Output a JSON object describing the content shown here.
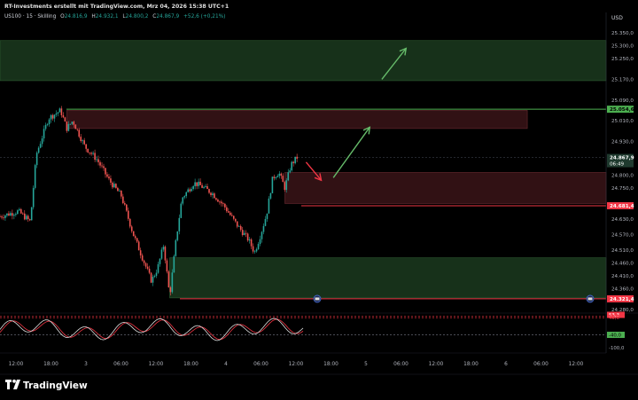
{
  "header": {
    "publisher": "RT-Investments erstellt mit TradingView.com, Mrz 04, 2026 15:38 UTC+1",
    "symbol": "US100 · 15 · Skilling",
    "open_label": "O",
    "open_value": "24.816,9",
    "high_label": "H",
    "high_value": "24.932,1",
    "low_label": "L",
    "low_value": "24.800,2",
    "close_label": "C",
    "close_value": "24.867,9",
    "change": "+52,6 (+0,21%)"
  },
  "currency": "USD",
  "brand": "TradingView",
  "colors": {
    "background": "#000000",
    "bull": "#26a69a",
    "bear": "#ef5350",
    "demand_zone": "#1b3a1f",
    "supply_zone": "#3a1418",
    "green_line": "#4caf50",
    "red_line": "#f23645",
    "arrow_green": "#66bb6a",
    "arrow_red": "#f23645"
  },
  "price_axis": {
    "ticks": [
      "25.350,0",
      "25.300,0",
      "25.250,0",
      "25.170,0",
      "25.090,0",
      "25.010,0",
      "24.930,0",
      "24.800,0",
      "24.750,0",
      "24.630,0",
      "24.570,0",
      "24.510,0",
      "24.460,0",
      "24.410,0",
      "24.360,0",
      "24.280,0"
    ],
    "badges": {
      "green_level": "25.054,6",
      "current_price": "24.867,9",
      "countdown": "06:49",
      "red_level": "24.681,4",
      "bottom_level": "24.321,4"
    }
  },
  "time_axis": {
    "labels": [
      "12:00",
      "18:00",
      "3",
      "06:00",
      "12:00",
      "18:00",
      "4",
      "06:00",
      "12:00",
      "18:00",
      "5",
      "06:00",
      "12:00",
      "18:00",
      "6",
      "06:00",
      "12:00"
    ]
  },
  "oscillator": {
    "ticks": [
      "53,3",
      "45,7",
      "40,0",
      "-40,0",
      "-100,0"
    ]
  },
  "chart_data": {
    "type": "candlestick",
    "instrument": "US100",
    "timeframe": "15",
    "ylim": [
      24280,
      25380
    ],
    "y_scale": [
      {
        "label": "25.350,0",
        "value": 25350
      },
      {
        "label": "24.280,0",
        "value": 24280
      }
    ],
    "levels": [
      {
        "value": 25054.6,
        "color": "green"
      },
      {
        "value": 24867.9,
        "color": "current"
      },
      {
        "value": 24681.4,
        "color": "red"
      },
      {
        "value": 24321.4,
        "color": "red"
      }
    ],
    "zones": [
      {
        "type": "demand",
        "from": 25165,
        "to": 25320,
        "start_session": 0.0,
        "end_session": 1.0
      },
      {
        "type": "supply",
        "from": 24980,
        "to": 25050,
        "start_session": 0.11,
        "end_session": 0.87
      },
      {
        "type": "supply",
        "from": 24690,
        "to": 24810,
        "start_session": 0.47,
        "end_session": 1.0
      },
      {
        "type": "demand",
        "from": 24325,
        "to": 24480,
        "start_session": 0.28,
        "end_session": 1.0
      }
    ],
    "price_path": [
      [
        0.0,
        24640
      ],
      [
        0.03,
        24660
      ],
      [
        0.05,
        24620
      ],
      [
        0.06,
        24880
      ],
      [
        0.08,
        25020
      ],
      [
        0.1,
        25050
      ],
      [
        0.11,
        24980
      ],
      [
        0.12,
        25010
      ],
      [
        0.14,
        24910
      ],
      [
        0.16,
        24860
      ],
      [
        0.18,
        24780
      ],
      [
        0.2,
        24720
      ],
      [
        0.22,
        24570
      ],
      [
        0.24,
        24450
      ],
      [
        0.25,
        24390
      ],
      [
        0.26,
        24440
      ],
      [
        0.27,
        24530
      ],
      [
        0.28,
        24330
      ],
      [
        0.29,
        24540
      ],
      [
        0.3,
        24710
      ],
      [
        0.32,
        24770
      ],
      [
        0.33,
        24760
      ],
      [
        0.35,
        24730
      ],
      [
        0.37,
        24680
      ],
      [
        0.39,
        24610
      ],
      [
        0.41,
        24550
      ],
      [
        0.42,
        24500
      ],
      [
        0.43,
        24570
      ],
      [
        0.44,
        24650
      ],
      [
        0.45,
        24790
      ],
      [
        0.46,
        24810
      ],
      [
        0.47,
        24750
      ],
      [
        0.48,
        24840
      ],
      [
        0.49,
        24867.9
      ]
    ],
    "projections": [
      {
        "color": "red",
        "from": [
          0.505,
          24850
        ],
        "to": [
          0.53,
          24780
        ]
      },
      {
        "color": "green",
        "from": [
          0.55,
          24790
        ],
        "to": [
          0.61,
          24985
        ]
      },
      {
        "color": "green",
        "from": [
          0.63,
          25170
        ],
        "to": [
          0.67,
          25290
        ]
      }
    ],
    "oscillator_levels": [
      53.3,
      45.7,
      40.0,
      -40.0,
      -100.0
    ]
  }
}
